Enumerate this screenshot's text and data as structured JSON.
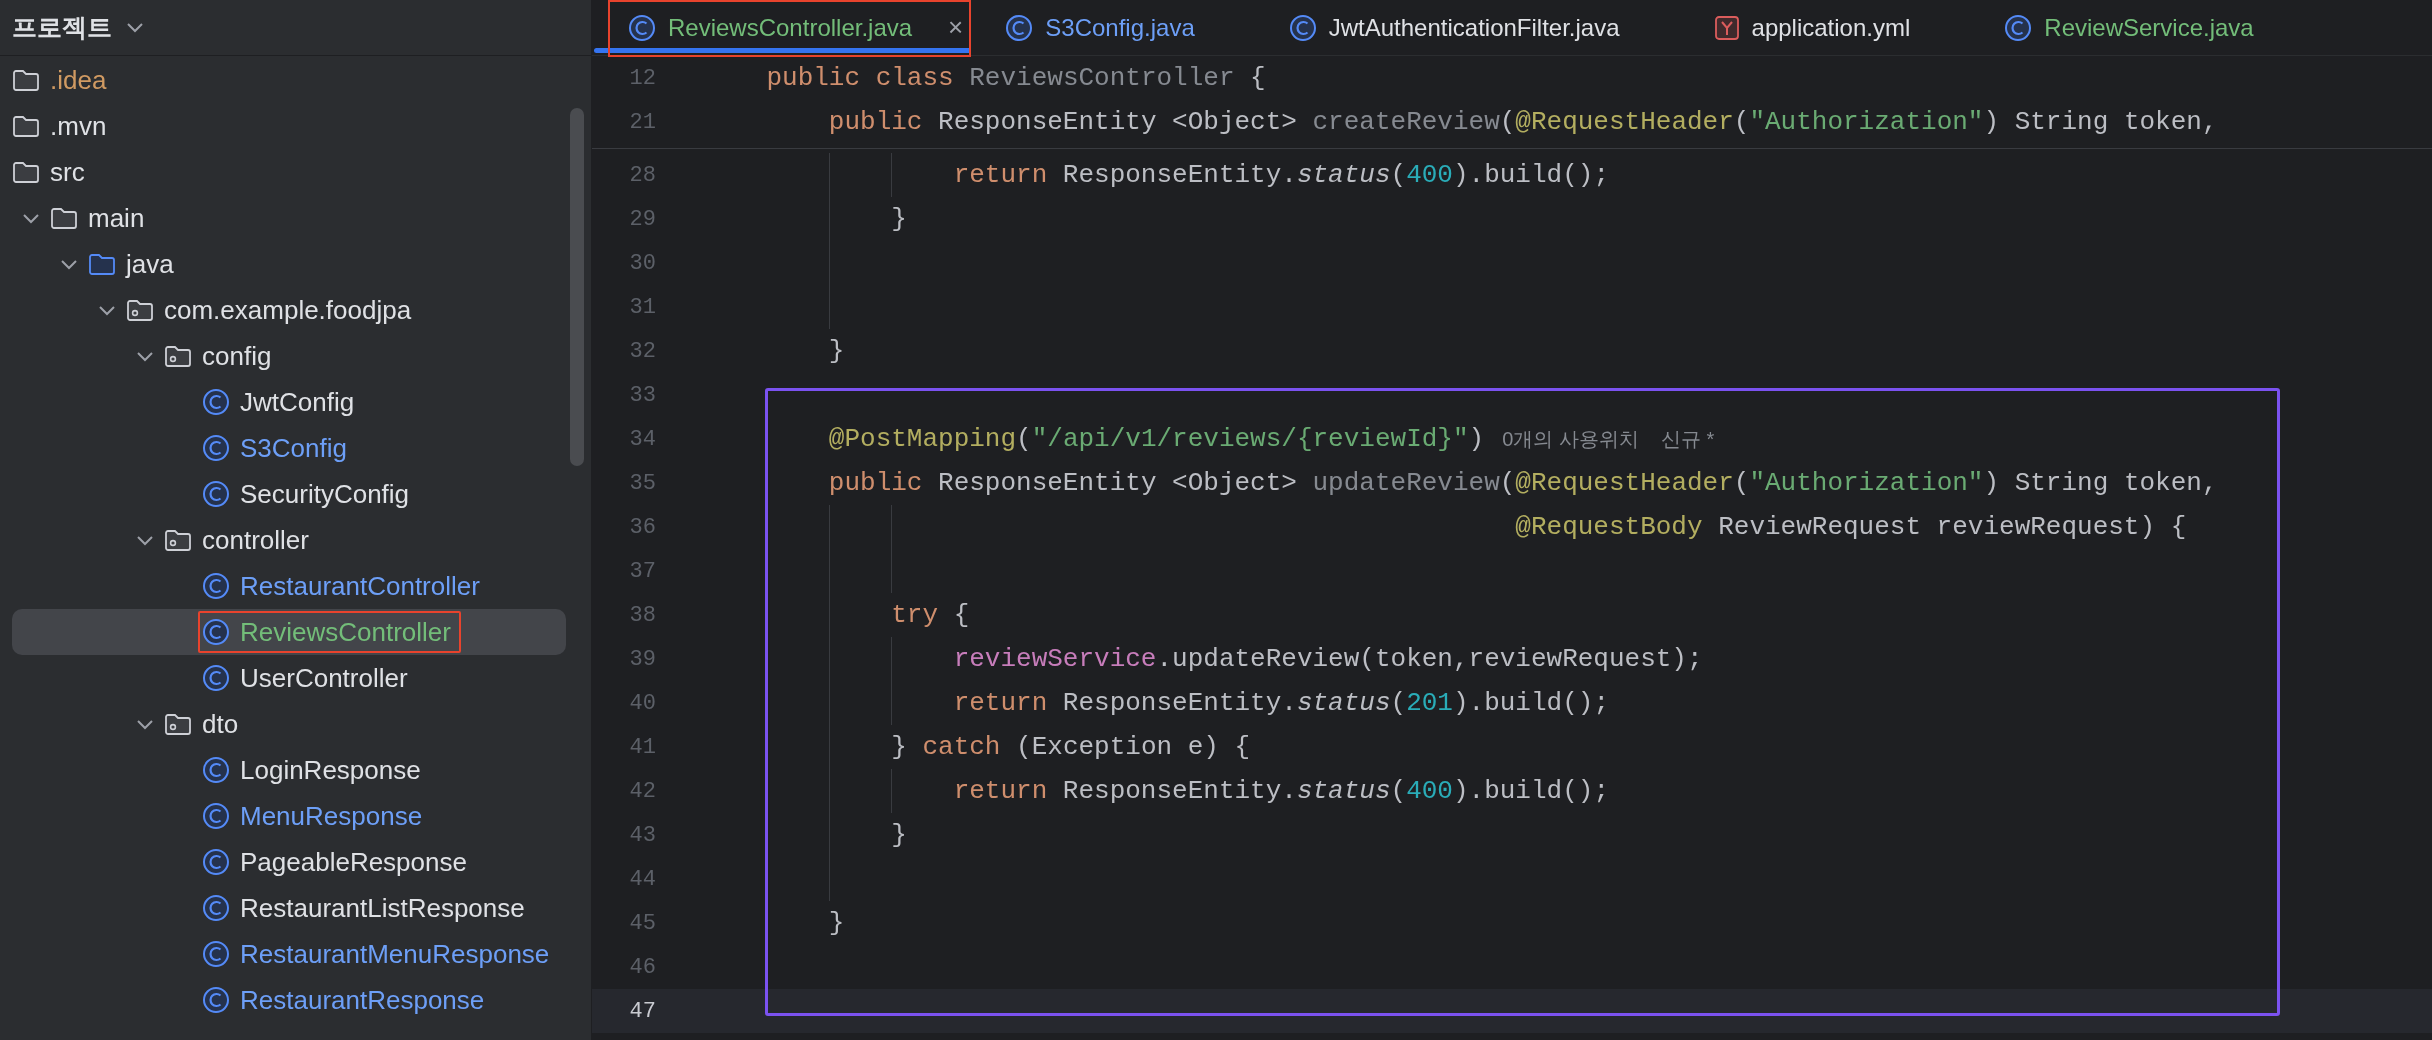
{
  "sidebar": {
    "title": "프로젝트",
    "tree": [
      {
        "label": ".idea",
        "kind": "folder",
        "color": "#d09a62",
        "selected": false,
        "outlined": false
      },
      {
        "label": ".mvn",
        "kind": "folder",
        "selected": false,
        "outlined": false
      },
      {
        "label": "src",
        "kind": "folder",
        "selected": false,
        "outlined": false,
        "children": [
          {
            "label": "main",
            "kind": "folder",
            "expanded": true,
            "selected": false,
            "outlined": false,
            "children": [
              {
                "label": "java",
                "kind": "source_folder",
                "expanded": true,
                "selected": false,
                "outlined": false,
                "children": [
                  {
                    "label": "com.example.foodjpa",
                    "kind": "package",
                    "expanded": true,
                    "selected": false,
                    "outlined": false,
                    "children": [
                      {
                        "label": "config",
                        "kind": "package",
                        "expanded": true,
                        "selected": false,
                        "outlined": false,
                        "children": [
                          {
                            "label": "JwtConfig",
                            "kind": "class",
                            "selected": false,
                            "outlined": false
                          },
                          {
                            "label": "S3Config",
                            "kind": "class",
                            "color": "#6d9ff7",
                            "selected": false,
                            "outlined": false
                          },
                          {
                            "label": "SecurityConfig",
                            "kind": "class",
                            "selected": false,
                            "outlined": false
                          }
                        ]
                      },
                      {
                        "label": "controller",
                        "kind": "package",
                        "expanded": true,
                        "selected": false,
                        "outlined": false,
                        "children": [
                          {
                            "label": "RestaurantController",
                            "kind": "class",
                            "color": "#6d9ff7",
                            "selected": false,
                            "outlined": false
                          },
                          {
                            "label": "ReviewsController",
                            "kind": "class",
                            "color": "#73bd79",
                            "selected": true,
                            "outlined": true
                          },
                          {
                            "label": "UserController",
                            "kind": "class",
                            "selected": false,
                            "outlined": false
                          }
                        ]
                      },
                      {
                        "label": "dto",
                        "kind": "package",
                        "expanded": true,
                        "selected": false,
                        "outlined": false,
                        "children": [
                          {
                            "label": "LoginResponse",
                            "kind": "class",
                            "selected": false,
                            "outlined": false
                          },
                          {
                            "label": "MenuResponse",
                            "kind": "class",
                            "color": "#6d9ff7",
                            "selected": false,
                            "outlined": false
                          },
                          {
                            "label": "PageableResponse",
                            "kind": "class",
                            "selected": false,
                            "outlined": false
                          },
                          {
                            "label": "RestaurantListResponse",
                            "kind": "class",
                            "selected": false,
                            "outlined": false
                          },
                          {
                            "label": "RestaurantMenuResponse",
                            "kind": "class",
                            "color": "#6d9ff7",
                            "selected": false,
                            "outlined": false
                          },
                          {
                            "label": "RestaurantResponse",
                            "kind": "class",
                            "color": "#6d9ff7",
                            "selected": false,
                            "outlined": false
                          }
                        ]
                      }
                    ]
                  }
                ]
              }
            ]
          }
        ]
      }
    ]
  },
  "tabs": [
    {
      "label": "ReviewsController.java",
      "kind": "class",
      "color": "#73bd79",
      "selected": true,
      "outlined": true,
      "close": "×"
    },
    {
      "label": "S3Config.java",
      "kind": "class",
      "color": "#6d9ff7",
      "selected": false,
      "outlined": false
    },
    {
      "label": "JwtAuthenticationFilter.java",
      "kind": "class",
      "color": "#dfe1e5",
      "selected": false,
      "outlined": false
    },
    {
      "label": "application.yml",
      "kind": "yaml",
      "color": "#dfe1e5",
      "selected": false,
      "outlined": false
    },
    {
      "label": "ReviewService.java",
      "kind": "class",
      "color": "#73bd79",
      "selected": false,
      "outlined": false
    }
  ],
  "editor": {
    "sticky_lines": [
      {
        "number": "12",
        "tokens": [
          {
            "kind": "kw",
            "text": "    public class "
          },
          {
            "kind": "dim",
            "text": "ReviewsController"
          },
          {
            "kind": "plain",
            "text": " {"
          }
        ]
      },
      {
        "number": "21",
        "tokens": [
          {
            "kind": "kw",
            "text": "        public "
          },
          {
            "kind": "plain",
            "text": "ResponseEntity <Object> "
          },
          {
            "kind": "dim",
            "text": "createReview"
          },
          {
            "kind": "plain",
            "text": "("
          },
          {
            "kind": "ann",
            "text": "@RequestHeader"
          },
          {
            "kind": "plain",
            "text": "("
          },
          {
            "kind": "str",
            "text": "\"Authorization\""
          },
          {
            "kind": "plain",
            "text": ") String token,"
          }
        ]
      }
    ],
    "sections": [
      {
        "boxed": false,
        "lines": [
          {
            "number": "28",
            "current": false,
            "tokens": [
              {
                "kind": "kw",
                "text": "                return "
              },
              {
                "kind": "plain",
                "text": "ResponseEntity."
              },
              {
                "kind": "italic",
                "text": "status"
              },
              {
                "kind": "plain",
                "text": "("
              },
              {
                "kind": "num",
                "text": "400"
              },
              {
                "kind": "plain",
                "text": ").build();"
              }
            ]
          },
          {
            "number": "29",
            "current": false,
            "tokens": [
              {
                "kind": "plain",
                "text": "            }"
              }
            ]
          },
          {
            "number": "30",
            "current": false
          },
          {
            "number": "31",
            "current": false
          },
          {
            "number": "32",
            "current": false,
            "tokens": [
              {
                "kind": "plain",
                "text": "        }"
              }
            ]
          }
        ]
      },
      {
        "boxed": true,
        "lines": [
          {
            "number": "33",
            "current": false
          },
          {
            "number": "34",
            "current": false,
            "tokens": [
              {
                "kind": "ann",
                "text": "        @PostMapping"
              },
              {
                "kind": "plain",
                "text": "("
              },
              {
                "kind": "str",
                "text": "\"/api/v1/reviews/{reviewId}\""
              },
              {
                "kind": "plain",
                "text": ")"
              }
            ],
            "hints": [
              "0개의 사용위치",
              "신규 *"
            ]
          },
          {
            "number": "35",
            "current": false,
            "tokens": [
              {
                "kind": "kw",
                "text": "        public "
              },
              {
                "kind": "plain",
                "text": "ResponseEntity <Object> "
              },
              {
                "kind": "dim",
                "text": "updateReview"
              },
              {
                "kind": "plain",
                "text": "("
              },
              {
                "kind": "ann",
                "text": "@RequestHeader"
              },
              {
                "kind": "plain",
                "text": "("
              },
              {
                "kind": "str",
                "text": "\"Authorization\""
              },
              {
                "kind": "plain",
                "text": ") String token,"
              }
            ]
          },
          {
            "number": "36",
            "current": false,
            "tokens": [
              {
                "kind": "ann",
                "text": "                                                    @RequestBody"
              },
              {
                "kind": "plain",
                "text": " ReviewRequest reviewRequest) {"
              }
            ]
          },
          {
            "number": "37",
            "current": false
          },
          {
            "number": "38",
            "current": false,
            "tokens": [
              {
                "kind": "kw",
                "text": "            try"
              },
              {
                "kind": "plain",
                "text": " {"
              }
            ]
          },
          {
            "number": "39",
            "current": false,
            "tokens": [
              {
                "kind": "field",
                "text": "                reviewService"
              },
              {
                "kind": "plain",
                "text": ".updateReview(token,reviewRequest);"
              }
            ]
          },
          {
            "number": "40",
            "current": false,
            "tokens": [
              {
                "kind": "kw",
                "text": "                return "
              },
              {
                "kind": "plain",
                "text": "ResponseEntity."
              },
              {
                "kind": "italic",
                "text": "status"
              },
              {
                "kind": "plain",
                "text": "("
              },
              {
                "kind": "num",
                "text": "201"
              },
              {
                "kind": "plain",
                "text": ").build();"
              }
            ]
          },
          {
            "number": "41",
            "current": false,
            "tokens": [
              {
                "kind": "plain",
                "text": "            } "
              },
              {
                "kind": "kw",
                "text": "catch"
              },
              {
                "kind": "plain",
                "text": " (Exception e) {"
              }
            ]
          },
          {
            "number": "42",
            "current": false,
            "tokens": [
              {
                "kind": "kw",
                "text": "                return "
              },
              {
                "kind": "plain",
                "text": "ResponseEntity."
              },
              {
                "kind": "italic",
                "text": "status"
              },
              {
                "kind": "plain",
                "text": "("
              },
              {
                "kind": "num",
                "text": "400"
              },
              {
                "kind": "plain",
                "text": ").build();"
              }
            ]
          },
          {
            "number": "43",
            "current": false,
            "tokens": [
              {
                "kind": "plain",
                "text": "            }"
              }
            ]
          },
          {
            "number": "44",
            "current": false
          },
          {
            "number": "45",
            "current": false,
            "tokens": [
              {
                "kind": "plain",
                "text": "        }"
              }
            ]
          },
          {
            "number": "46",
            "current": false
          },
          {
            "number": "47",
            "current": true
          }
        ]
      }
    ]
  }
}
